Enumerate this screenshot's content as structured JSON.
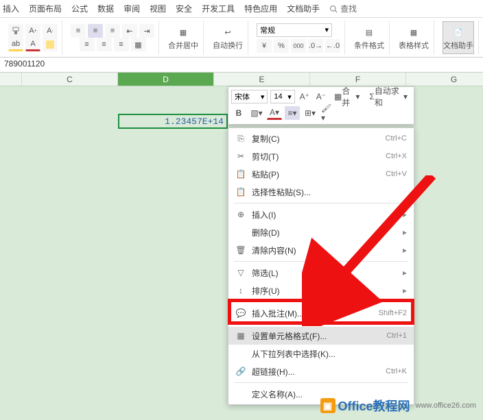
{
  "menubar": {
    "items": [
      "插入",
      "页面布局",
      "公式",
      "数据",
      "审阅",
      "视图",
      "安全",
      "开发工具",
      "特色应用",
      "文档助手"
    ],
    "search": "查找"
  },
  "ribbon": {
    "merge": "合并居中",
    "wrap": "自动换行",
    "numfmt": "常规",
    "condfmt": "条件格式",
    "tblfmt": "表格样式",
    "dochelp": "文档助手",
    "sum": "求和"
  },
  "formula_bar": "789001120",
  "cols": [
    "C",
    "D",
    "E",
    "F",
    "G"
  ],
  "cell_value": "1.23457E+14",
  "mini": {
    "font": "宋体",
    "size": "14",
    "merge": "合并",
    "sum": "自动求和"
  },
  "menu": [
    {
      "icon": "copy",
      "label": "复制(C)",
      "key": "Ctrl+C"
    },
    {
      "icon": "cut",
      "label": "剪切(T)",
      "key": "Ctrl+X"
    },
    {
      "icon": "paste",
      "label": "粘贴(P)",
      "key": "Ctrl+V"
    },
    {
      "icon": "pastesp",
      "label": "选择性粘贴(S)...",
      "key": ""
    },
    {
      "sep": true
    },
    {
      "icon": "insert",
      "label": "插入(I)",
      "key": "",
      "sub": true
    },
    {
      "icon": "",
      "label": "删除(D)",
      "key": "",
      "sub": true
    },
    {
      "icon": "clear",
      "label": "清除内容(N)",
      "key": "",
      "sub": true
    },
    {
      "sep": true
    },
    {
      "icon": "filter",
      "label": "筛选(L)",
      "key": "",
      "sub": true
    },
    {
      "icon": "sort",
      "label": "排序(U)",
      "key": "",
      "sub": true
    },
    {
      "sep": true
    },
    {
      "icon": "comment",
      "label": "插入批注(M)...",
      "key": "Shift+F2"
    },
    {
      "sep": true
    },
    {
      "icon": "fmt",
      "label": "设置单元格格式(F)...",
      "key": "Ctrl+1",
      "sel": true
    },
    {
      "icon": "",
      "label": "从下拉列表中选择(K)...",
      "key": ""
    },
    {
      "icon": "link",
      "label": "超链接(H)...",
      "key": "Ctrl+K"
    },
    {
      "sep": true
    },
    {
      "icon": "",
      "label": "定义名称(A)...",
      "key": ""
    }
  ],
  "watermark": {
    "brand": "Office",
    "suffix": "教程网",
    "url": "www.office26.com"
  }
}
